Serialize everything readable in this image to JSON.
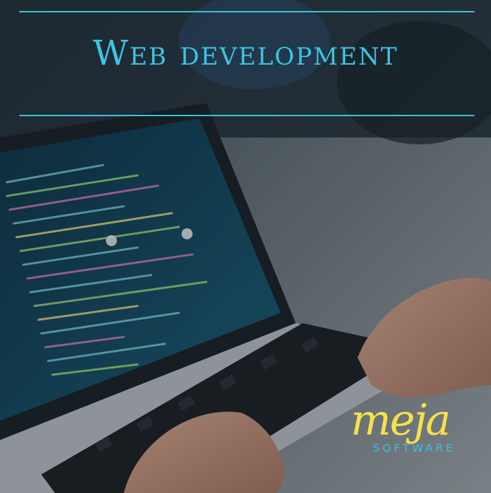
{
  "headline": "Web development",
  "logo": {
    "brand": "meja",
    "tagline": "SOFTWARE",
    "colors": {
      "brand": "#f5e24a",
      "tagline": "#3bbde0"
    }
  },
  "colors": {
    "accent": "#39c6e0"
  }
}
